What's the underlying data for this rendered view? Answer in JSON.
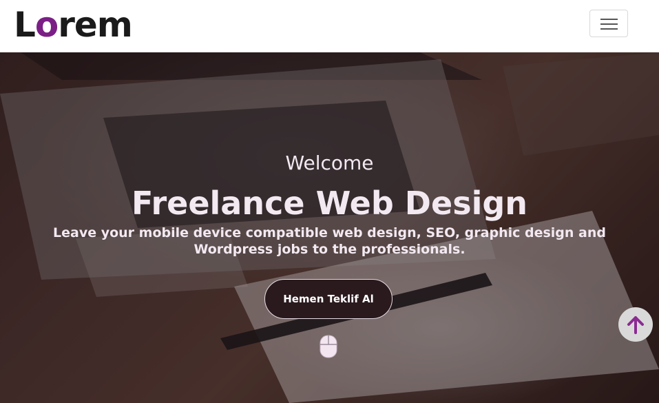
{
  "navbar": {
    "logo_prefix": "L",
    "logo_accent": "o",
    "logo_suffix": "rem",
    "toggler_icon": "hamburger-menu-icon"
  },
  "hero": {
    "subtitle": "Welcome",
    "title": "Freelance Web Design",
    "description": "Leave your mobile device compatible web design, SEO, graphic design and Wordpress jobs to the professionals.",
    "cta_label": "Hemen Teklif Al",
    "scroll_icon": "mouse-icon"
  },
  "scroll_top": {
    "icon": "arrow-up-icon"
  },
  "colors": {
    "brand_accent": "#7b1f86",
    "text_light": "#f3e9f1",
    "button_bg": "#2a1a1e",
    "scroll_top_bg": "#d9d9d9"
  }
}
